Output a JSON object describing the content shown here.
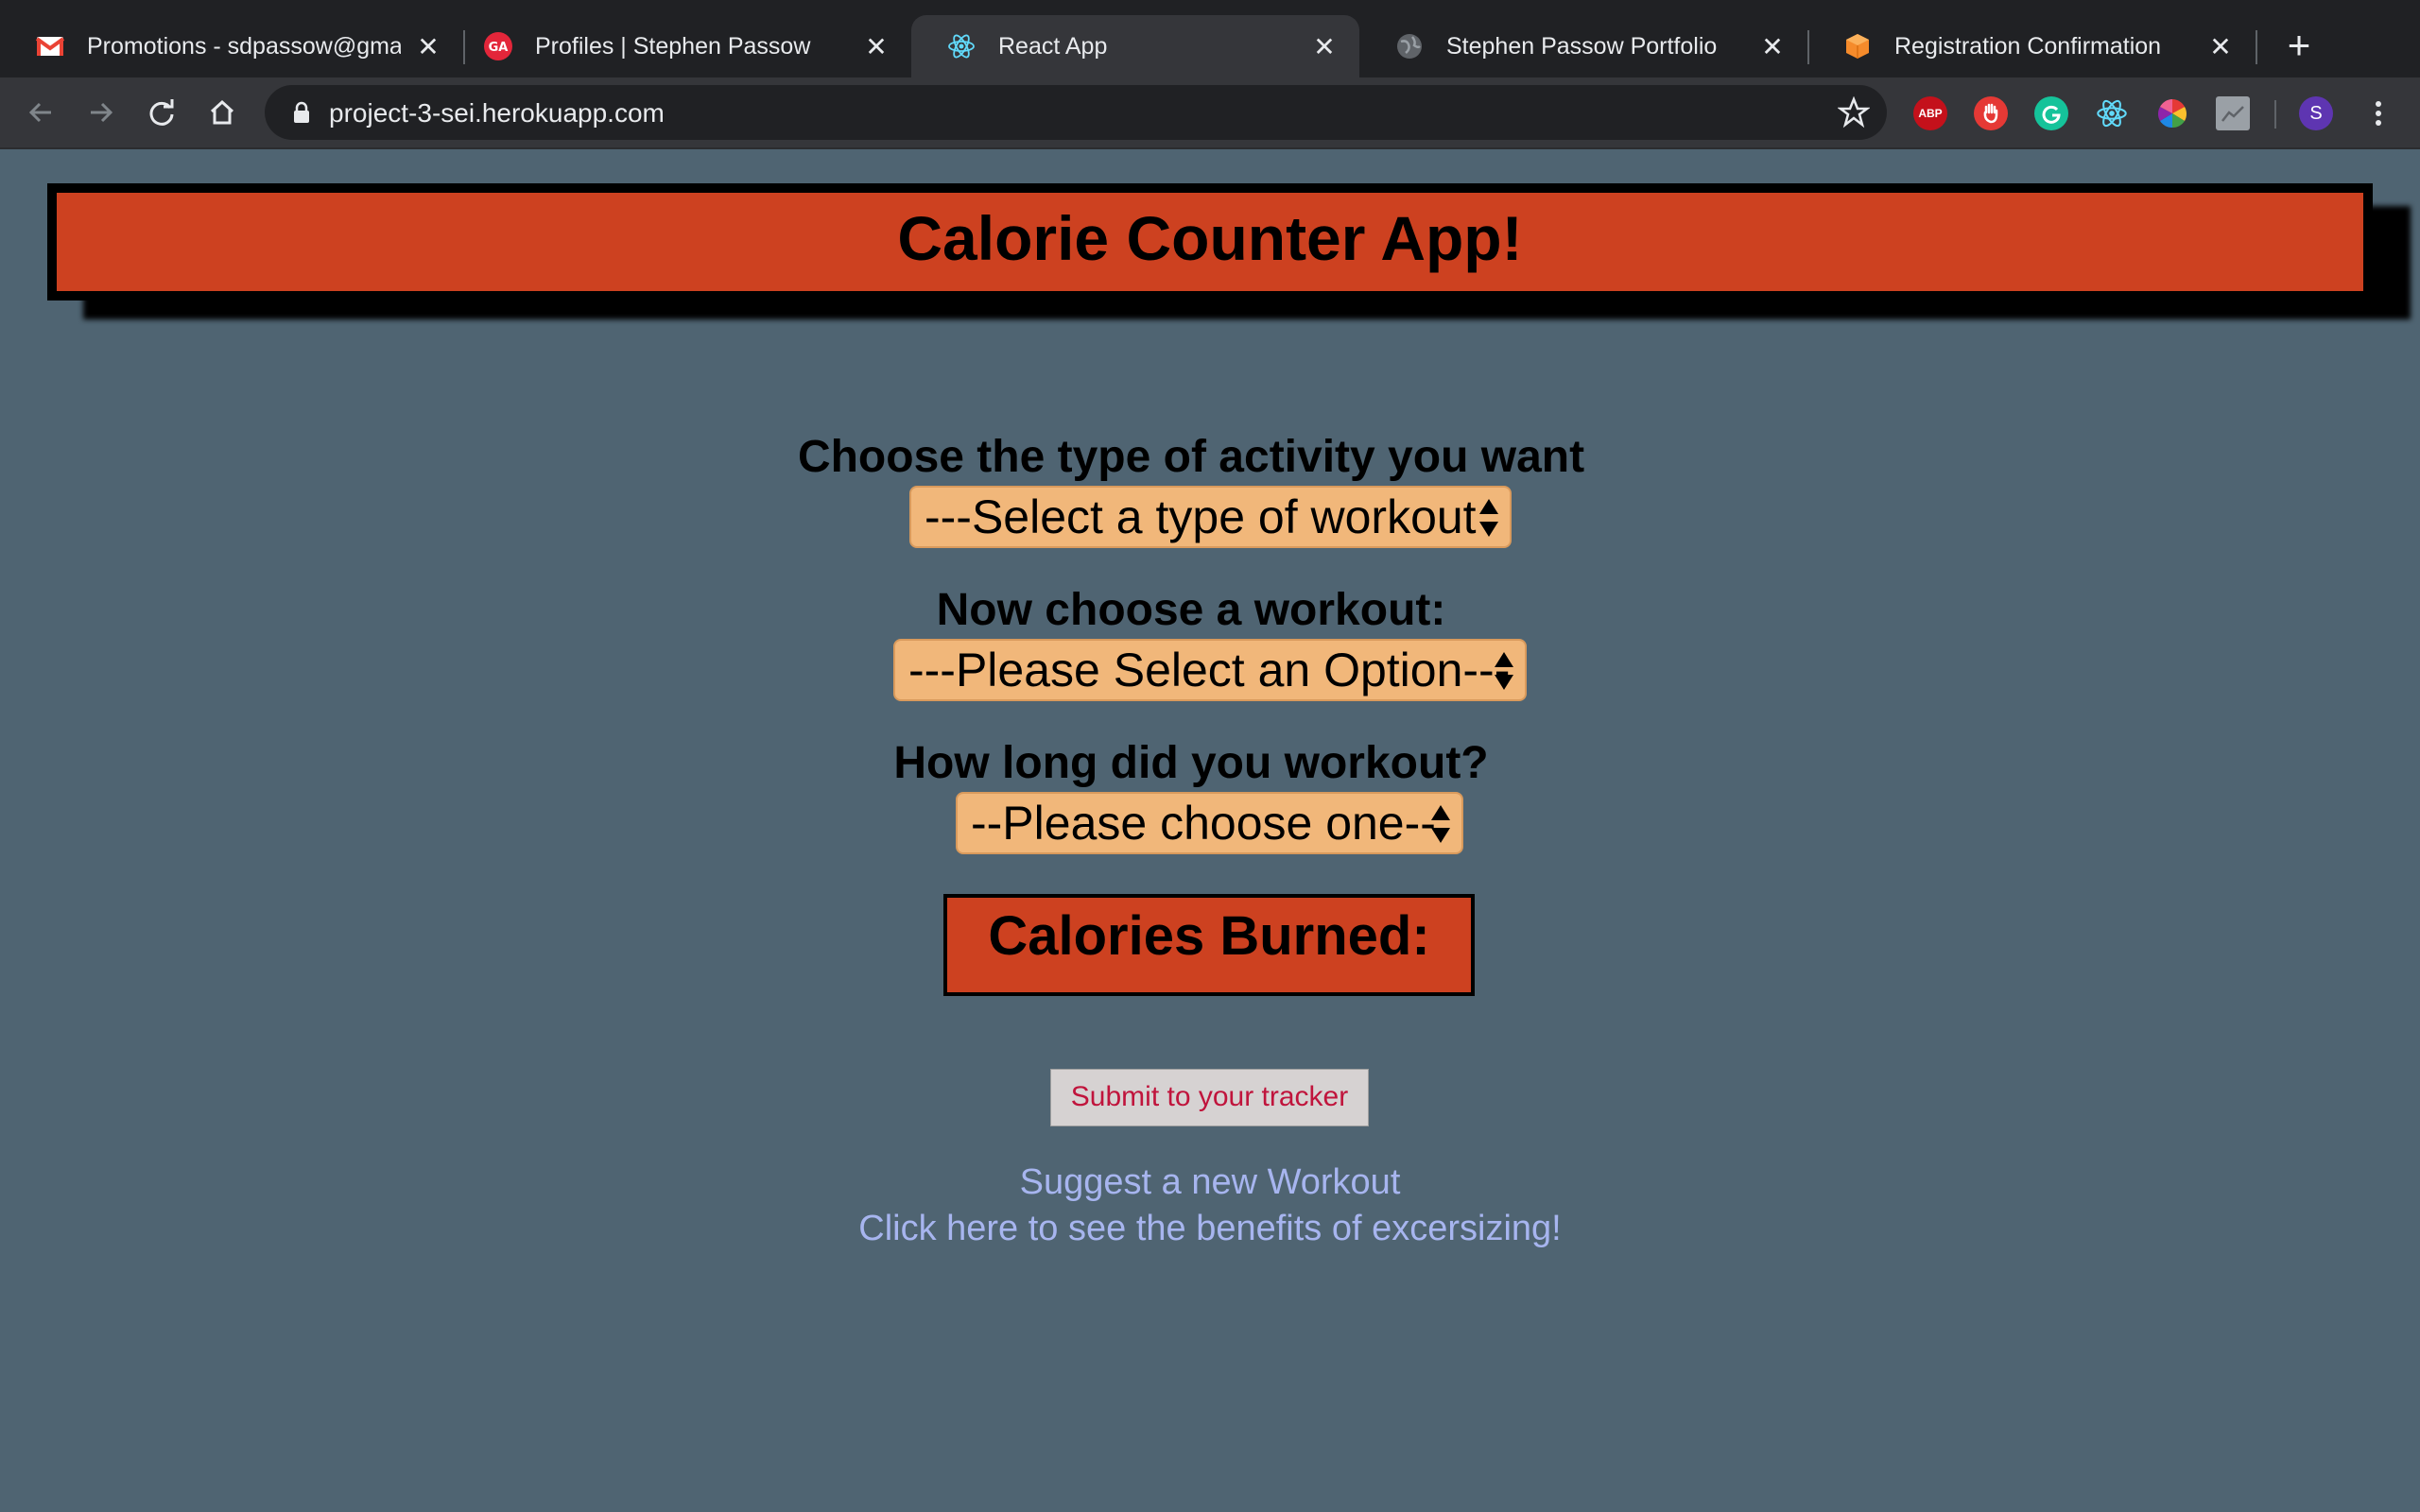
{
  "browser": {
    "tabs": [
      {
        "title": "Promotions - sdpassow@gmail.com",
        "icon": "gmail-icon",
        "active": false
      },
      {
        "title": "Profiles | Stephen Passow",
        "icon": "ga-icon",
        "active": false
      },
      {
        "title": "React App",
        "icon": "react-icon",
        "active": true
      },
      {
        "title": "Stephen Passow Portfolio",
        "icon": "globe-icon",
        "active": false
      },
      {
        "title": "Registration Confirmation",
        "icon": "box-icon",
        "active": false
      }
    ],
    "url": "project-3-sei.herokuapp.com",
    "profile_initial": "S",
    "extensions": {
      "abp_label": "ABP"
    }
  },
  "page": {
    "title": "Calorie Counter App!",
    "activity_label": "Choose the type of activity you want",
    "activity_select": "---Select a type of workout",
    "workout_label": "Now choose a workout:",
    "workout_select": "---Please Select an Option---",
    "duration_label": "How long did you workout?",
    "duration_select": "--Please choose one--",
    "calories_label": "Calories Burned:",
    "submit_label": "Submit to your tracker",
    "suggest_link": "Suggest a new Workout",
    "benefits_link": "Click here to see the benefits of excersizing!"
  },
  "colors": {
    "page_bg": "#4f6472",
    "header_bg": "#cd4120",
    "select_bg": "#f1b77a",
    "link": "#a7b5ef",
    "submit_text": "#c0143c"
  }
}
